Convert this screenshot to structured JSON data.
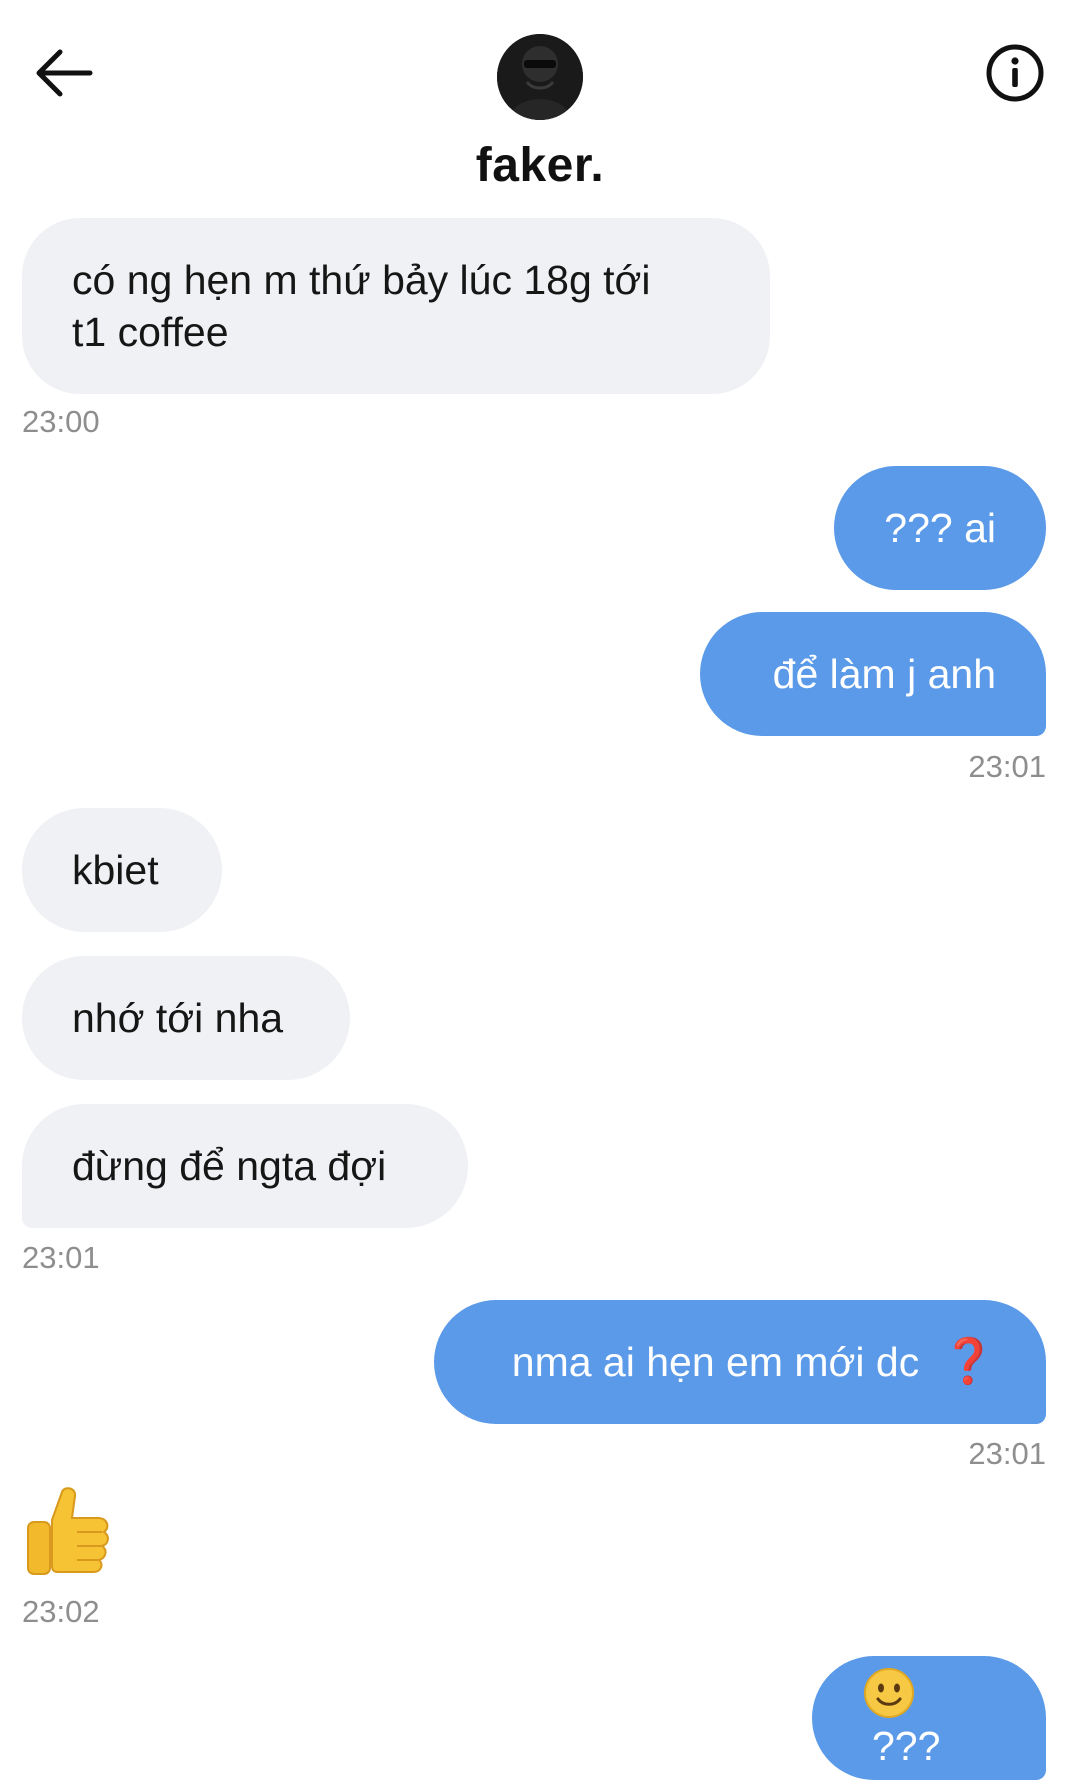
{
  "header": {
    "contact_name": "faker."
  },
  "icons": {
    "back": "arrow-left-icon",
    "info": "info-circle-icon",
    "avatar": "avatar-photo"
  },
  "colors": {
    "incoming_bubble": "#eff1f4",
    "outgoing_bubble": "#5b9ae9",
    "timestamp": "#8e8e8e",
    "red_question": "#e0242e"
  },
  "messages": [
    {
      "direction": "in",
      "text_line1": "có ng hẹn m thứ bảy lúc 18g tới",
      "text_line2": "t1 coffee"
    },
    {
      "direction": "out",
      "text": "??? ai"
    },
    {
      "direction": "out",
      "text": "để làm j anh"
    },
    {
      "direction": "in",
      "text": "kbiet"
    },
    {
      "direction": "in",
      "text": "nhớ tới nha"
    },
    {
      "direction": "in",
      "text": "đừng để ngta đợi"
    },
    {
      "direction": "out",
      "text": "nma ai hẹn em mới dc",
      "emoji": "❓"
    },
    {
      "direction": "in",
      "emoji": "thumbs-up"
    },
    {
      "direction": "out",
      "emoji": "slightly-smiling-face",
      "text": "???"
    }
  ],
  "timestamps": [
    "23:00",
    "23:01",
    "23:01",
    "23:01",
    "23:02"
  ]
}
